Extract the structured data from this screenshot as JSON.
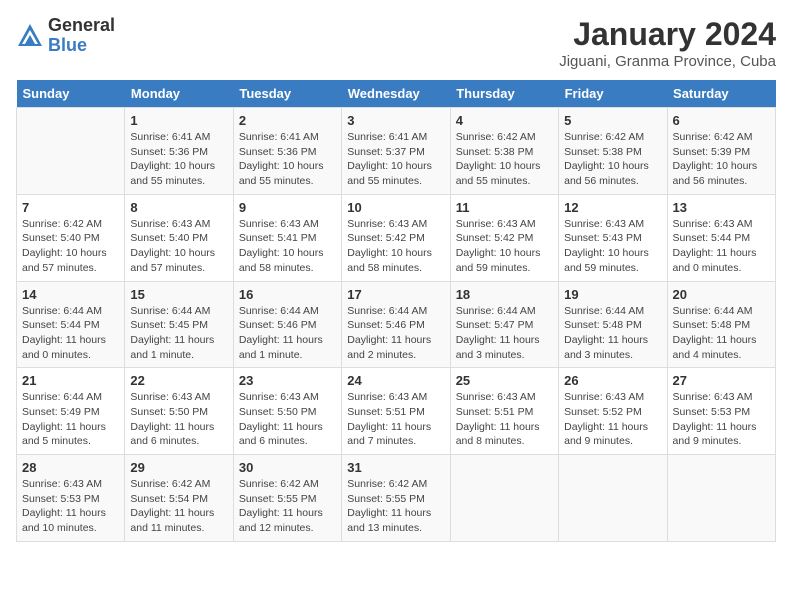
{
  "header": {
    "logo_general": "General",
    "logo_blue": "Blue",
    "month_title": "January 2024",
    "location": "Jiguani, Granma Province, Cuba"
  },
  "days_of_week": [
    "Sunday",
    "Monday",
    "Tuesday",
    "Wednesday",
    "Thursday",
    "Friday",
    "Saturday"
  ],
  "weeks": [
    [
      {
        "day": "",
        "sunrise": "",
        "sunset": "",
        "daylight": ""
      },
      {
        "day": "1",
        "sunrise": "Sunrise: 6:41 AM",
        "sunset": "Sunset: 5:36 PM",
        "daylight": "Daylight: 10 hours and 55 minutes."
      },
      {
        "day": "2",
        "sunrise": "Sunrise: 6:41 AM",
        "sunset": "Sunset: 5:36 PM",
        "daylight": "Daylight: 10 hours and 55 minutes."
      },
      {
        "day": "3",
        "sunrise": "Sunrise: 6:41 AM",
        "sunset": "Sunset: 5:37 PM",
        "daylight": "Daylight: 10 hours and 55 minutes."
      },
      {
        "day": "4",
        "sunrise": "Sunrise: 6:42 AM",
        "sunset": "Sunset: 5:38 PM",
        "daylight": "Daylight: 10 hours and 55 minutes."
      },
      {
        "day": "5",
        "sunrise": "Sunrise: 6:42 AM",
        "sunset": "Sunset: 5:38 PM",
        "daylight": "Daylight: 10 hours and 56 minutes."
      },
      {
        "day": "6",
        "sunrise": "Sunrise: 6:42 AM",
        "sunset": "Sunset: 5:39 PM",
        "daylight": "Daylight: 10 hours and 56 minutes."
      }
    ],
    [
      {
        "day": "7",
        "sunrise": "Sunrise: 6:42 AM",
        "sunset": "Sunset: 5:40 PM",
        "daylight": "Daylight: 10 hours and 57 minutes."
      },
      {
        "day": "8",
        "sunrise": "Sunrise: 6:43 AM",
        "sunset": "Sunset: 5:40 PM",
        "daylight": "Daylight: 10 hours and 57 minutes."
      },
      {
        "day": "9",
        "sunrise": "Sunrise: 6:43 AM",
        "sunset": "Sunset: 5:41 PM",
        "daylight": "Daylight: 10 hours and 58 minutes."
      },
      {
        "day": "10",
        "sunrise": "Sunrise: 6:43 AM",
        "sunset": "Sunset: 5:42 PM",
        "daylight": "Daylight: 10 hours and 58 minutes."
      },
      {
        "day": "11",
        "sunrise": "Sunrise: 6:43 AM",
        "sunset": "Sunset: 5:42 PM",
        "daylight": "Daylight: 10 hours and 59 minutes."
      },
      {
        "day": "12",
        "sunrise": "Sunrise: 6:43 AM",
        "sunset": "Sunset: 5:43 PM",
        "daylight": "Daylight: 10 hours and 59 minutes."
      },
      {
        "day": "13",
        "sunrise": "Sunrise: 6:43 AM",
        "sunset": "Sunset: 5:44 PM",
        "daylight": "Daylight: 11 hours and 0 minutes."
      }
    ],
    [
      {
        "day": "14",
        "sunrise": "Sunrise: 6:44 AM",
        "sunset": "Sunset: 5:44 PM",
        "daylight": "Daylight: 11 hours and 0 minutes."
      },
      {
        "day": "15",
        "sunrise": "Sunrise: 6:44 AM",
        "sunset": "Sunset: 5:45 PM",
        "daylight": "Daylight: 11 hours and 1 minute."
      },
      {
        "day": "16",
        "sunrise": "Sunrise: 6:44 AM",
        "sunset": "Sunset: 5:46 PM",
        "daylight": "Daylight: 11 hours and 1 minute."
      },
      {
        "day": "17",
        "sunrise": "Sunrise: 6:44 AM",
        "sunset": "Sunset: 5:46 PM",
        "daylight": "Daylight: 11 hours and 2 minutes."
      },
      {
        "day": "18",
        "sunrise": "Sunrise: 6:44 AM",
        "sunset": "Sunset: 5:47 PM",
        "daylight": "Daylight: 11 hours and 3 minutes."
      },
      {
        "day": "19",
        "sunrise": "Sunrise: 6:44 AM",
        "sunset": "Sunset: 5:48 PM",
        "daylight": "Daylight: 11 hours and 3 minutes."
      },
      {
        "day": "20",
        "sunrise": "Sunrise: 6:44 AM",
        "sunset": "Sunset: 5:48 PM",
        "daylight": "Daylight: 11 hours and 4 minutes."
      }
    ],
    [
      {
        "day": "21",
        "sunrise": "Sunrise: 6:44 AM",
        "sunset": "Sunset: 5:49 PM",
        "daylight": "Daylight: 11 hours and 5 minutes."
      },
      {
        "day": "22",
        "sunrise": "Sunrise: 6:43 AM",
        "sunset": "Sunset: 5:50 PM",
        "daylight": "Daylight: 11 hours and 6 minutes."
      },
      {
        "day": "23",
        "sunrise": "Sunrise: 6:43 AM",
        "sunset": "Sunset: 5:50 PM",
        "daylight": "Daylight: 11 hours and 6 minutes."
      },
      {
        "day": "24",
        "sunrise": "Sunrise: 6:43 AM",
        "sunset": "Sunset: 5:51 PM",
        "daylight": "Daylight: 11 hours and 7 minutes."
      },
      {
        "day": "25",
        "sunrise": "Sunrise: 6:43 AM",
        "sunset": "Sunset: 5:51 PM",
        "daylight": "Daylight: 11 hours and 8 minutes."
      },
      {
        "day": "26",
        "sunrise": "Sunrise: 6:43 AM",
        "sunset": "Sunset: 5:52 PM",
        "daylight": "Daylight: 11 hours and 9 minutes."
      },
      {
        "day": "27",
        "sunrise": "Sunrise: 6:43 AM",
        "sunset": "Sunset: 5:53 PM",
        "daylight": "Daylight: 11 hours and 9 minutes."
      }
    ],
    [
      {
        "day": "28",
        "sunrise": "Sunrise: 6:43 AM",
        "sunset": "Sunset: 5:53 PM",
        "daylight": "Daylight: 11 hours and 10 minutes."
      },
      {
        "day": "29",
        "sunrise": "Sunrise: 6:42 AM",
        "sunset": "Sunset: 5:54 PM",
        "daylight": "Daylight: 11 hours and 11 minutes."
      },
      {
        "day": "30",
        "sunrise": "Sunrise: 6:42 AM",
        "sunset": "Sunset: 5:55 PM",
        "daylight": "Daylight: 11 hours and 12 minutes."
      },
      {
        "day": "31",
        "sunrise": "Sunrise: 6:42 AM",
        "sunset": "Sunset: 5:55 PM",
        "daylight": "Daylight: 11 hours and 13 minutes."
      },
      {
        "day": "",
        "sunrise": "",
        "sunset": "",
        "daylight": ""
      },
      {
        "day": "",
        "sunrise": "",
        "sunset": "",
        "daylight": ""
      },
      {
        "day": "",
        "sunrise": "",
        "sunset": "",
        "daylight": ""
      }
    ]
  ]
}
